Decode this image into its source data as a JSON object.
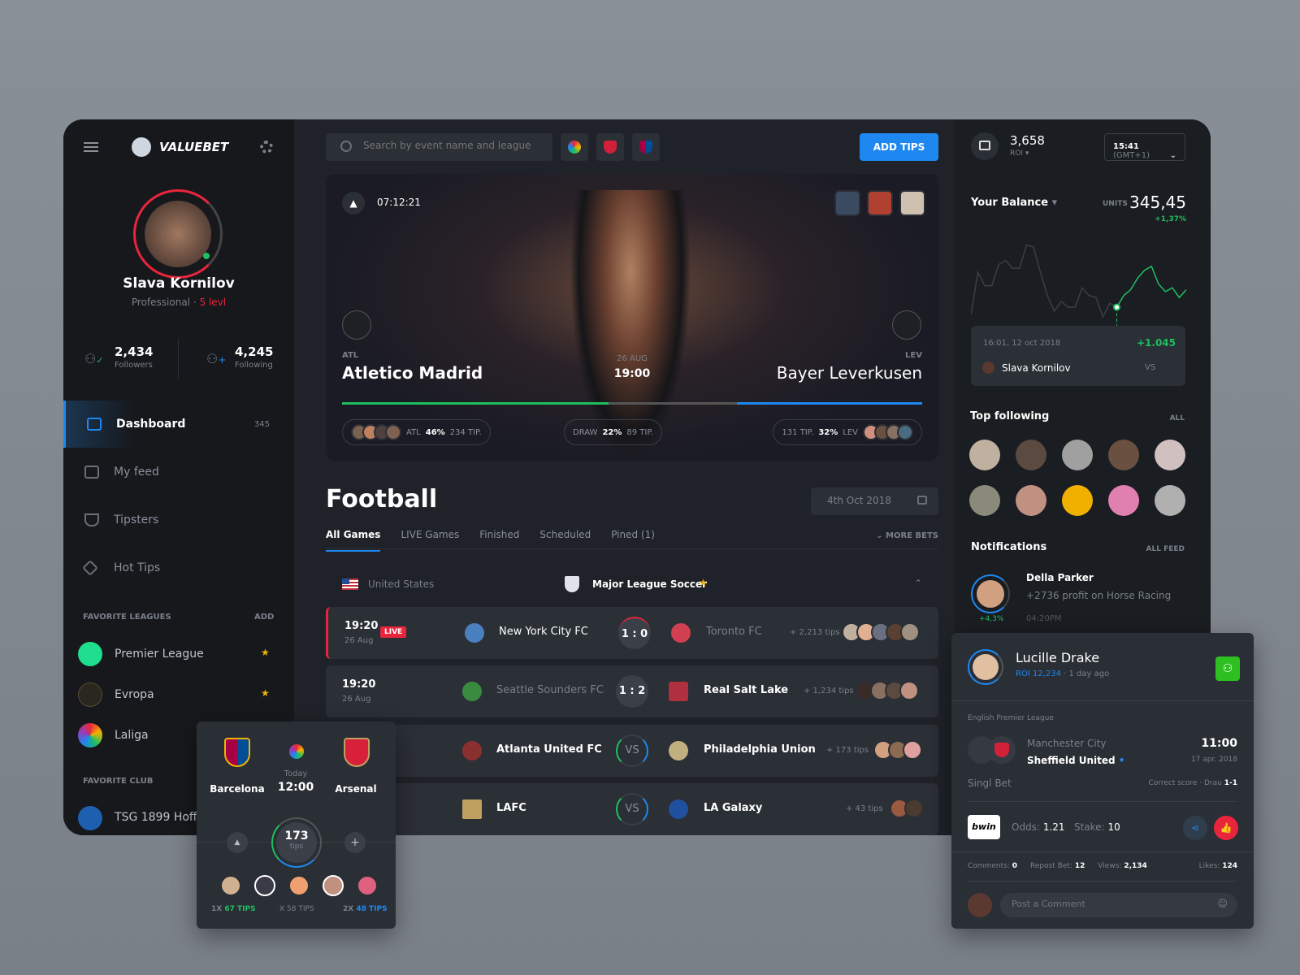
{
  "brand": {
    "name": "VALUEBET",
    "accent": "#1e88f0",
    "green": "#1fbf5f",
    "red": "#e8253c"
  },
  "profile": {
    "name": "Slava Kornilov",
    "role": "Professional",
    "level": "5 levl",
    "followers": "2,434",
    "followers_label": "Followers",
    "following": "4,245",
    "following_label": "Following"
  },
  "nav": [
    {
      "label": "Dashboard",
      "count": "345",
      "icon": "folder-icon"
    },
    {
      "label": "My feed",
      "icon": "feed-icon"
    },
    {
      "label": "Tipsters",
      "icon": "filter-icon"
    },
    {
      "label": "Hot Tips",
      "icon": "send-icon"
    }
  ],
  "fav_leagues": {
    "title": "FAVORITE LEAGUES",
    "add": "ADD",
    "items": [
      {
        "label": "Premier League"
      },
      {
        "label": "Evropa"
      },
      {
        "label": "Laliga"
      }
    ]
  },
  "fav_club": {
    "title": "FAVORITE CLUB",
    "items": [
      {
        "label": "TSG 1899 Hoffenheim"
      }
    ]
  },
  "search": {
    "placeholder": "Search by event name and league"
  },
  "add_tips": "ADD TIPS",
  "hero": {
    "timer": "07:12:21",
    "home_abbr": "ATL",
    "home": "Atletico Madrid",
    "away_abbr": "LEV",
    "away": "Bayer Leverkusen",
    "date": "26 AUG",
    "time": "19:00",
    "home_pct": "46%",
    "home_tips": "234 TIP.",
    "draw_label": "DRAW",
    "draw_pct": "22%",
    "draw_tips": "89 TIP.",
    "away_pct": "32%",
    "away_tips": "131 TIP.",
    "split": [
      46,
      22,
      32
    ]
  },
  "section": {
    "title": "Football",
    "date": "4th Oct 2018",
    "more": "MORE BETS",
    "tabs": [
      "All Games",
      "LIVE Games",
      "Finished",
      "Scheduled",
      "Pined (1)"
    ],
    "country": "United States",
    "league": "Major League Soccer"
  },
  "matches": [
    {
      "time": "19:20",
      "date": "26 Aug",
      "live": "LIVE",
      "home": "New York City FC",
      "score": "1 : 0",
      "away": "Toronto FC",
      "tips": "+ 2,213 tips"
    },
    {
      "time": "19:20",
      "date": "26 Aug",
      "home": "Seattle Sounders FC",
      "score": "1 : 2",
      "away": "Real Salt Lake",
      "tips": "+ 1,234 tips"
    },
    {
      "home": "Atlanta United FC",
      "score": "VS",
      "away": "Philadelphia Union",
      "tips": "+ 173 tips"
    },
    {
      "home": "LAFC",
      "score": "VS",
      "away": "LA Galaxy",
      "tips": "+ 43 tips"
    }
  ],
  "top": {
    "roi": "3,658",
    "roi_label": "ROI",
    "clock": "15:41",
    "tz": "(GMT+1)"
  },
  "balance": {
    "title": "Your Balance",
    "units": "UNITS",
    "value": "345,45",
    "change": "+1,37%",
    "tooltip_date": "16:01, 12 oct 2018",
    "tooltip_value": "+1.045",
    "tooltip_user": "Slava Kornilov",
    "vs": "VS",
    "chart": [
      40,
      18,
      25,
      25,
      14,
      12,
      16,
      16,
      4,
      5,
      18,
      30,
      38,
      33,
      36,
      36,
      26,
      30,
      31,
      41,
      34,
      36,
      30,
      27,
      21,
      17,
      15,
      24,
      28,
      26,
      31,
      27
    ]
  },
  "following": {
    "title": "Top following",
    "all": "ALL"
  },
  "notifications": {
    "title": "Notifications",
    "all": "ALL FEED",
    "items": [
      {
        "name": "Della Parker",
        "text": "+2736 profit on Horse Racing",
        "pct": "+4,3%",
        "time": "04:20PM"
      }
    ]
  },
  "match_card": {
    "home": "Barcelona",
    "away": "Arsenal",
    "day": "Today",
    "time": "12:00",
    "tips": "173",
    "tips_label": "tips",
    "odds": [
      {
        "k": "1X",
        "v": "67 TIPS"
      },
      {
        "k": "X",
        "v": "58 TIPS"
      },
      {
        "k": "2X",
        "v": "48 TIPS"
      }
    ]
  },
  "tip_card": {
    "name": "Lucille Drake",
    "roi": "ROI 12,234",
    "ago": "1 day ago",
    "league": "English Premier League",
    "home": "Manchester City",
    "away": "Sheffield United",
    "time": "11:00",
    "date": "17 apr. 2018",
    "bet": "Singl Bet",
    "market": "Correct score",
    "pick": "Drau",
    "pick_val": "1-1",
    "bookie": "bwin",
    "odds_label": "Odds:",
    "odds": "1.21",
    "stake_label": "Stake:",
    "stake": "10",
    "comments_label": "Comments:",
    "comments": "0",
    "repost_label": "Repost Bet:",
    "repost": "12",
    "views_label": "Views:",
    "views": "2,134",
    "likes_label": "Likes:",
    "likes": "124",
    "comment_placeholder": "Post a Comment"
  }
}
